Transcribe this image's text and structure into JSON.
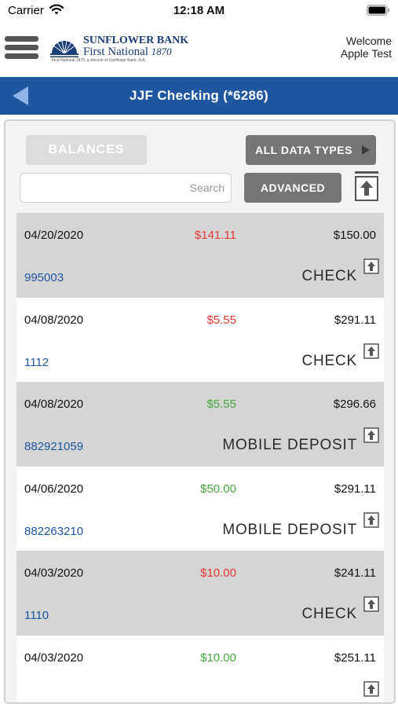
{
  "status_bar": {
    "carrier": "Carrier",
    "time": "12:18 AM",
    "icons": [
      "wifi-icon",
      "battery-icon"
    ]
  },
  "header": {
    "menu_icon": "hamburger-menu-icon",
    "logo": {
      "line1": "SUNFLOWER BANK",
      "line2": "First National",
      "year": "1870",
      "tagline": "First National 1870, a division of Sunflower Bank, N.A."
    },
    "welcome": {
      "line1": "Welcome",
      "line2": "Apple Test"
    }
  },
  "nav": {
    "back_icon": "back-arrow-icon",
    "title": "JJF Checking (*6286)",
    "color": "#1e56a0"
  },
  "controls": {
    "balances_label": "BALANCES",
    "data_types_label": "ALL DATA TYPES",
    "search_placeholder": "Search",
    "search_value": "",
    "advanced_label": "ADVANCED",
    "export_icon": "export-icon"
  },
  "transactions": [
    {
      "date": "04/20/2020",
      "amount": "$141.11",
      "amount_kind": "debit",
      "balance": "$150.00",
      "ref": "995003",
      "type": "CHECK",
      "shaded": true
    },
    {
      "date": "04/08/2020",
      "amount": "$5.55",
      "amount_kind": "debit",
      "balance": "$291.11",
      "ref": "1112",
      "type": "CHECK",
      "shaded": false
    },
    {
      "date": "04/08/2020",
      "amount": "$5.55",
      "amount_kind": "credit",
      "balance": "$296.66",
      "ref": "882921059",
      "type": "MOBILE DEPOSIT",
      "shaded": true
    },
    {
      "date": "04/06/2020",
      "amount": "$50.00",
      "amount_kind": "credit",
      "balance": "$291.11",
      "ref": "882263210",
      "type": "MOBILE DEPOSIT",
      "shaded": false
    },
    {
      "date": "04/03/2020",
      "amount": "$10.00",
      "amount_kind": "debit",
      "balance": "$241.11",
      "ref": "1110",
      "type": "CHECK",
      "shaded": true
    },
    {
      "date": "04/03/2020",
      "amount": "$10.00",
      "amount_kind": "credit",
      "balance": "$251.11",
      "ref": "",
      "type": "",
      "shaded": false
    }
  ],
  "colors": {
    "debit": "#e53935",
    "credit": "#43a83a",
    "ref_link": "#1e56a0",
    "button_dark": "#757575",
    "button_light": "#dcdcdc"
  }
}
